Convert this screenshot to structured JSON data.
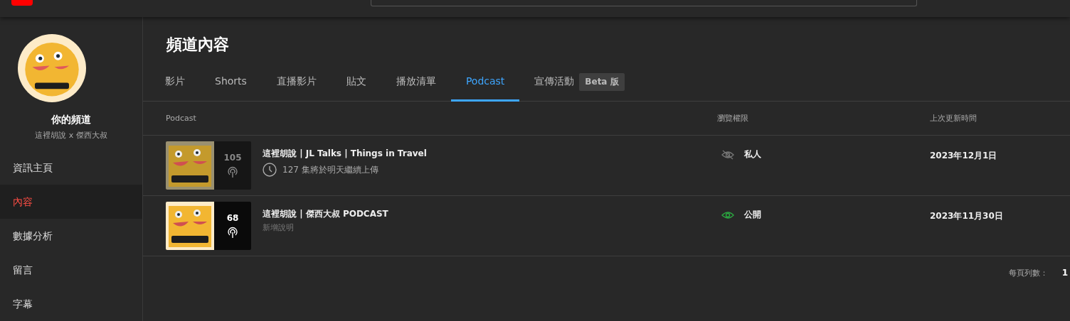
{
  "channel": {
    "name": "你的頻道",
    "subtitle": "這裡胡說 x 傑西大叔"
  },
  "sidebar": {
    "items": [
      {
        "label": "資訊主頁",
        "selected": false
      },
      {
        "label": "內容",
        "selected": true
      },
      {
        "label": "數據分析",
        "selected": false
      },
      {
        "label": "留言",
        "selected": false
      },
      {
        "label": "字幕",
        "selected": false
      }
    ]
  },
  "page_title": "頻道內容",
  "tabs": [
    {
      "label": "影片",
      "selected": false
    },
    {
      "label": "Shorts",
      "selected": false
    },
    {
      "label": "直播影片",
      "selected": false
    },
    {
      "label": "貼文",
      "selected": false
    },
    {
      "label": "播放清單",
      "selected": false
    },
    {
      "label": "Podcast",
      "selected": true
    },
    {
      "label": "宣傳活動",
      "selected": false,
      "badge": "Beta 版"
    }
  ],
  "table": {
    "columns": [
      "Podcast",
      "瀏覽權限",
      "上次更新時間"
    ],
    "rows": [
      {
        "title": "這裡胡說 | JL Talks | Things in Travel",
        "count": "105",
        "subtitle": {
          "text": "127 集將於明天繼續上傳",
          "kind": "scheduled"
        },
        "visibility": {
          "label": "私人",
          "kind": "private"
        },
        "date": "2023年12月1日"
      },
      {
        "title": "這裡胡說 | 傑西大叔 PODCAST",
        "count": "68",
        "subtitle": {
          "text": "新增說明",
          "kind": "hint"
        },
        "visibility": {
          "label": "公開",
          "kind": "public"
        },
        "date": "2023年11月30日"
      }
    ]
  },
  "footer": {
    "rows_per_page_label": "每頁列數：",
    "rows_per_page": "1"
  }
}
